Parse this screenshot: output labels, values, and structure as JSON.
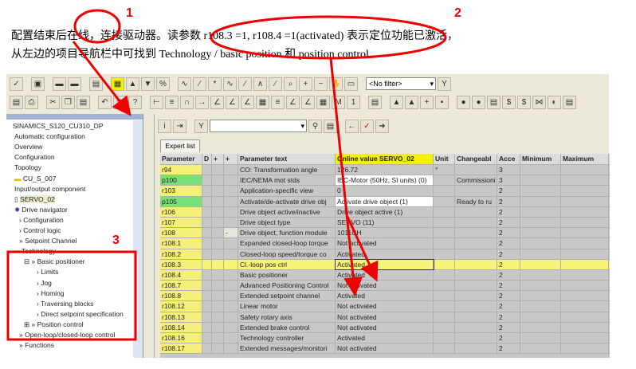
{
  "caption": {
    "line1": "配置结束后在线，连接驱动器。读参数 r108.3 =1, r108.4 =1(activated) 表示定位功能已激活，",
    "line2": "从左边的项目导航栏中可找到 Technology / basic position 和  position control"
  },
  "annotations": {
    "n1": "1",
    "n2": "2",
    "n3": "3"
  },
  "toolbar": {
    "filter": "<No filter>"
  },
  "tree": [
    "SINAMICS_S120_CU310_DP",
    "Automatic configuration",
    "Overview",
    "Configuration",
    "Topology",
    "CU_S_007",
    "Input/output component",
    "SERVO_02",
    "Drive navigator",
    "Configuration",
    "Control logic",
    "Setpoint Channel",
    "Technology",
    "Basic positioner",
    "Limits",
    "Jog",
    "Homing",
    "Traversing blocks",
    "Direct setpoint specification",
    "Position control",
    "Open-loop/closed-loop control",
    "Functions"
  ],
  "tab": "Expert list",
  "headers": [
    "Parameter",
    "D",
    "+",
    "+",
    "Parameter text",
    "Online value SERVO_02",
    "Unit",
    "Changeabl",
    "Acce",
    "Minimum",
    "Maximum"
  ],
  "rows": [
    {
      "p": "r94",
      "btn": "",
      "t": "CO: Transformation angle",
      "v": "126.72",
      "u": "°",
      "c": "",
      "a": "3"
    },
    {
      "p": "p100",
      "btn": "",
      "t": "IEC/NEMA mot stds",
      "v": "IEC-Motor (50Hz, SI units) (0)",
      "u": "",
      "c": "Commissioni",
      "a": "3"
    },
    {
      "p": "r103",
      "btn": "",
      "t": "Application-specific view",
      "v": "0",
      "u": "",
      "c": "",
      "a": "2"
    },
    {
      "p": "p105",
      "btn": "",
      "t": "Activate/de-activate drive obj",
      "v": "Activate drive object (1)",
      "u": "",
      "c": "Ready to ru",
      "a": "2"
    },
    {
      "p": "r106",
      "btn": "",
      "t": "Drive object active/inactive",
      "v": "Drive object active (1)",
      "u": "",
      "c": "",
      "a": "2"
    },
    {
      "p": "r107",
      "btn": "",
      "t": "Drive object type",
      "v": "SERVO (11)",
      "u": "",
      "c": "",
      "a": "2"
    },
    {
      "p": "r108",
      "btn": "-",
      "t": "Drive object, function module",
      "v": "1011CH",
      "u": "",
      "c": "",
      "a": "2"
    },
    {
      "p": "r108.1",
      "btn": "",
      "t": "Expanded closed-loop torque",
      "v": "Not activated",
      "u": "",
      "c": "",
      "a": "2"
    },
    {
      "p": "r108.2",
      "btn": "",
      "t": "Closed-loop speed/torque co",
      "v": "Activated",
      "u": "",
      "c": "",
      "a": "2"
    },
    {
      "p": "r108.3",
      "btn": "",
      "t": "Cl.-loop pos ctrl",
      "v": "Activated",
      "u": "",
      "c": "",
      "a": "2"
    },
    {
      "p": "r108.4",
      "btn": "",
      "t": "Basic positioner",
      "v": "Activated",
      "u": "",
      "c": "",
      "a": "2"
    },
    {
      "p": "r108.7",
      "btn": "",
      "t": "Advanced Positioning Control",
      "v": "Not activated",
      "u": "",
      "c": "",
      "a": "2"
    },
    {
      "p": "r108.8",
      "btn": "",
      "t": "Extended setpoint channel",
      "v": "Activated",
      "u": "",
      "c": "",
      "a": "2"
    },
    {
      "p": "r108.12",
      "btn": "",
      "t": "Linear motor",
      "v": "Not activated",
      "u": "",
      "c": "",
      "a": "2"
    },
    {
      "p": "r108.13",
      "btn": "",
      "t": "Safety rotary axis",
      "v": "Not activated",
      "u": "",
      "c": "",
      "a": "2"
    },
    {
      "p": "r108.14",
      "btn": "",
      "t": "Extended brake control",
      "v": "Not activated",
      "u": "",
      "c": "",
      "a": "2"
    },
    {
      "p": "r108.16",
      "btn": "",
      "t": "Technology controller",
      "v": "Activated",
      "u": "",
      "c": "",
      "a": "2"
    },
    {
      "p": "r108.17",
      "btn": "",
      "t": "Extended messages/monitori",
      "v": "Not activated",
      "u": "",
      "c": "",
      "a": "2"
    }
  ]
}
